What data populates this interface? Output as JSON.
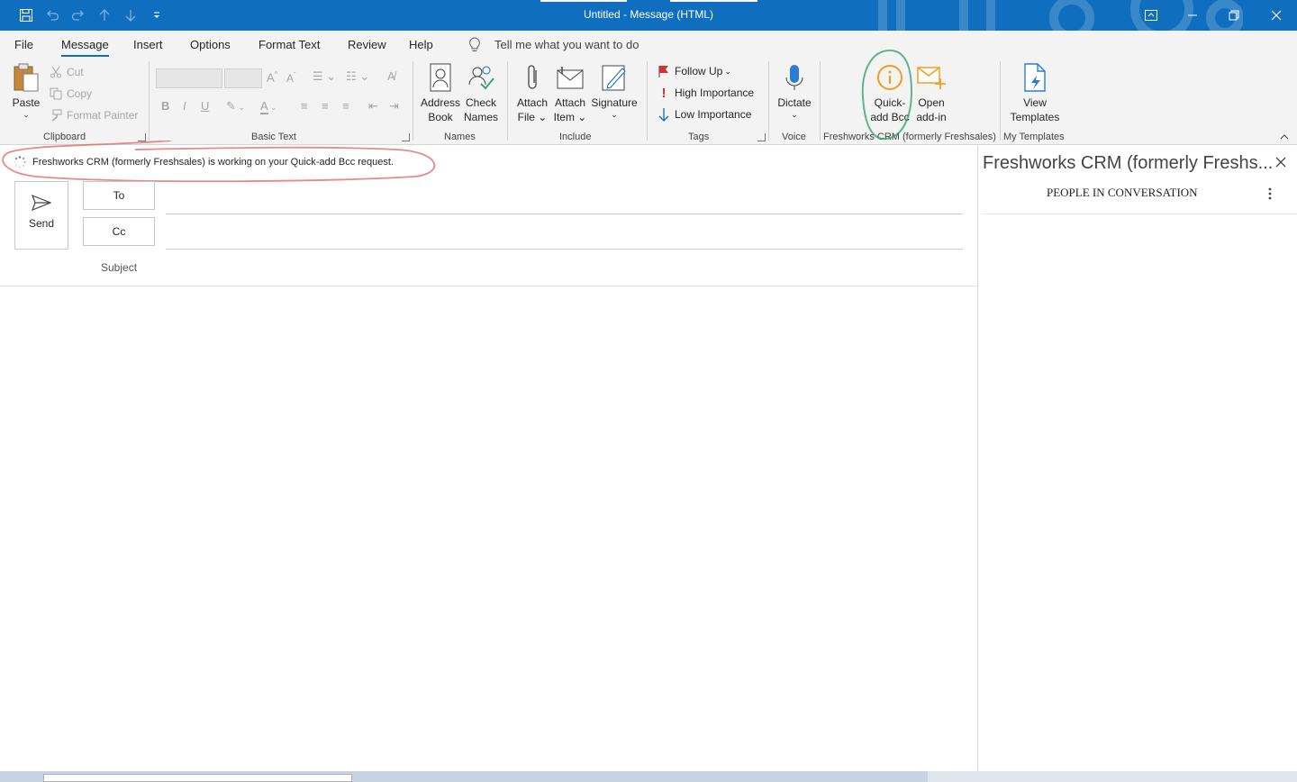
{
  "window": {
    "title": "Untitled  -  Message (HTML)",
    "colors": {
      "titlebar": "#106ebe",
      "accent": "#106ebe",
      "annotation_red": "#e06060",
      "annotation_green": "#2e9e6e"
    }
  },
  "quick_access": {
    "icons": [
      "save-icon",
      "undo-icon",
      "redo-icon",
      "previous-item-icon",
      "next-item-icon",
      "customize-qat-icon"
    ]
  },
  "menu": {
    "tabs": [
      "File",
      "Message",
      "Insert",
      "Options",
      "Format Text",
      "Review",
      "Help"
    ],
    "active_tab": "Message",
    "tell_me": "Tell me what you want to do"
  },
  "ribbon": {
    "clipboard": {
      "label": "Clipboard",
      "paste": "Paste",
      "cut": "Cut",
      "copy": "Copy",
      "format_painter": "Format Painter"
    },
    "basic_text": {
      "label": "Basic Text",
      "bold": "B",
      "italic": "I",
      "underline": "U"
    },
    "names": {
      "label": "Names",
      "address_book": [
        "Address",
        "Book"
      ],
      "check_names": [
        "Check",
        "Names"
      ]
    },
    "include": {
      "label": "Include",
      "attach_file": [
        "Attach",
        "File"
      ],
      "attach_item": [
        "Attach",
        "Item"
      ],
      "signature": "Signature"
    },
    "tags": {
      "label": "Tags",
      "follow_up": "Follow Up",
      "high_importance": "High Importance",
      "low_importance": "Low Importance"
    },
    "voice": {
      "label": "Voice",
      "dictate": "Dictate"
    },
    "freshworks": {
      "label": "Freshworks CRM (formerly Freshsales)",
      "quick_add_bcc": [
        "Quick-",
        "add Bcc"
      ],
      "open_addin": [
        "Open",
        "add-in"
      ]
    },
    "templates": {
      "label": "My Templates",
      "view_templates": [
        "View",
        "Templates"
      ]
    }
  },
  "infobar": {
    "message": "Freshworks CRM (formerly Freshsales) is working on your Quick-add Bcc request."
  },
  "compose": {
    "send": "Send",
    "to": "To",
    "cc": "Cc",
    "subject": "Subject"
  },
  "pane": {
    "title": "Freshworks CRM (formerly Freshs...",
    "heading": "PEOPLE IN CONVERSATION"
  }
}
